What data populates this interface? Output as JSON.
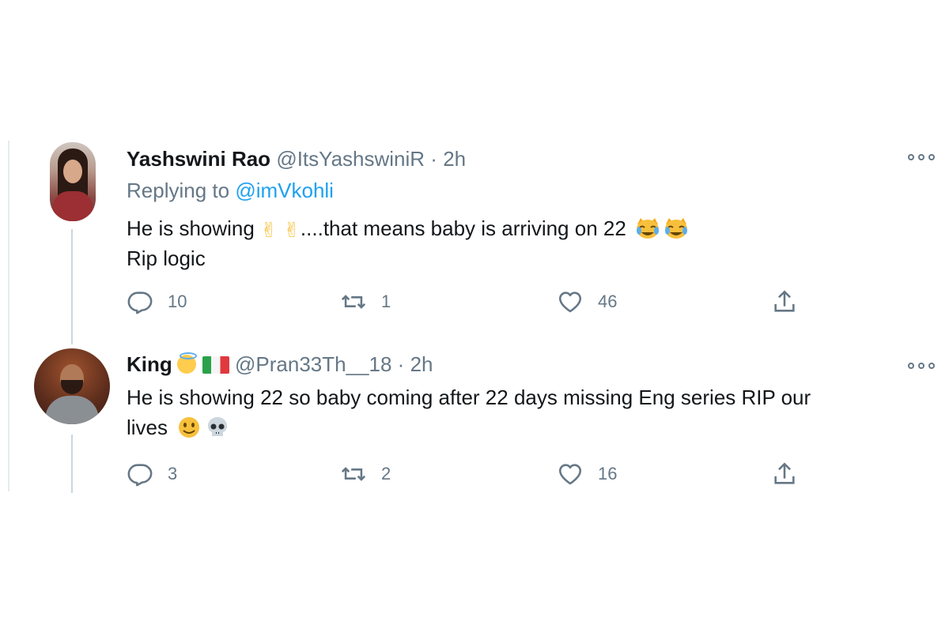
{
  "tweets": [
    {
      "author_name": "Yashswini Rao",
      "handle": "@ItsYashswiniR",
      "separator": "·",
      "time": "2h",
      "replying_prefix": "Replying to",
      "replying_to": "@imVkohli",
      "text_line1_a": "He is showing",
      "text_line1_b": "....that means baby is arriving on 22",
      "text_line2": "Rip logic",
      "replies": "10",
      "retweets": "1",
      "likes": "46"
    },
    {
      "author_name": "King",
      "handle": "@Pran33Th__18",
      "separator": "·",
      "time": "2h",
      "text_line1": "He is showing 22 so baby coming after 22 days missing Eng series RIP our",
      "text_line2": "lives",
      "replies": "3",
      "retweets": "2",
      "likes": "16"
    }
  ],
  "colors": {
    "text": "#14171a",
    "secondary": "#657786",
    "link": "#1da1f2",
    "thread_line": "#ccd6dd"
  },
  "icons": [
    "reply-icon",
    "retweet-icon",
    "like-icon",
    "share-icon",
    "more-icon"
  ]
}
